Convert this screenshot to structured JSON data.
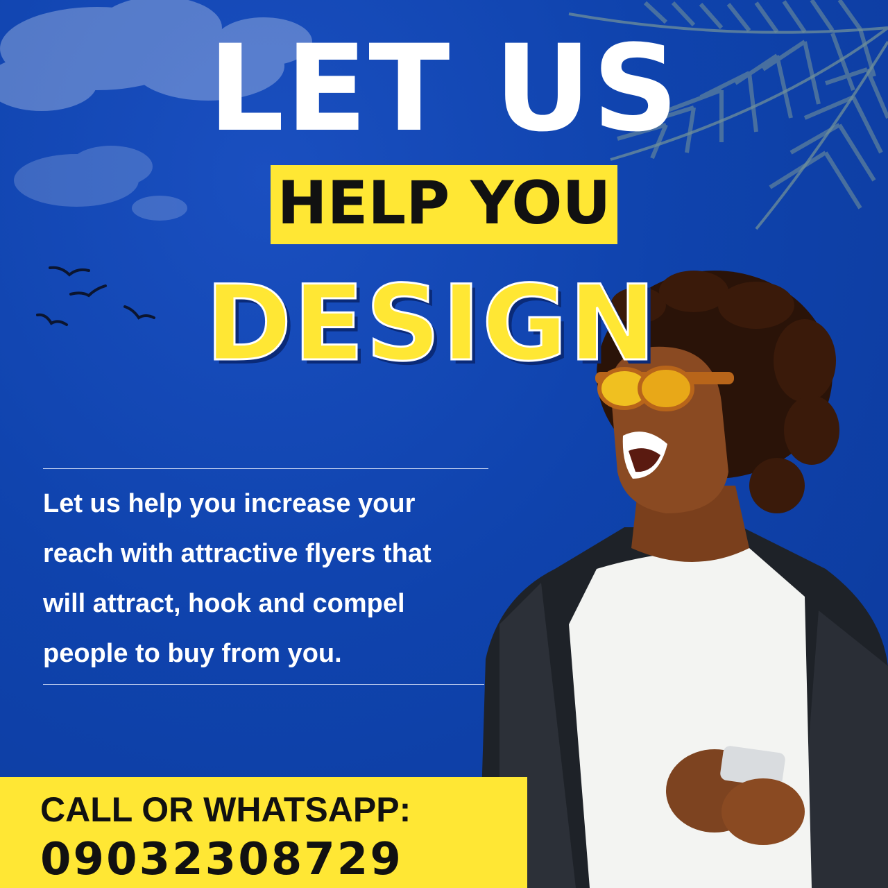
{
  "headline": {
    "line1": "LET US",
    "line2": "HELP YOU",
    "line3": "DESIGN"
  },
  "body": {
    "lines": [
      "Let us help you increase your",
      "reach with attractive flyers that",
      "will attract, hook and compel",
      "people to buy from you."
    ]
  },
  "contact": {
    "label": "CALL OR WHATSAPP:",
    "phone": "09032308729"
  },
  "colors": {
    "background": "#0f43ad",
    "accent_yellow": "#ffe734",
    "text_white": "#ffffff",
    "text_dark": "#111111"
  },
  "decorations": [
    "cloud-graphic",
    "palm-leaf-graphic",
    "birds-graphic",
    "smiling-man-with-phone-photo"
  ]
}
